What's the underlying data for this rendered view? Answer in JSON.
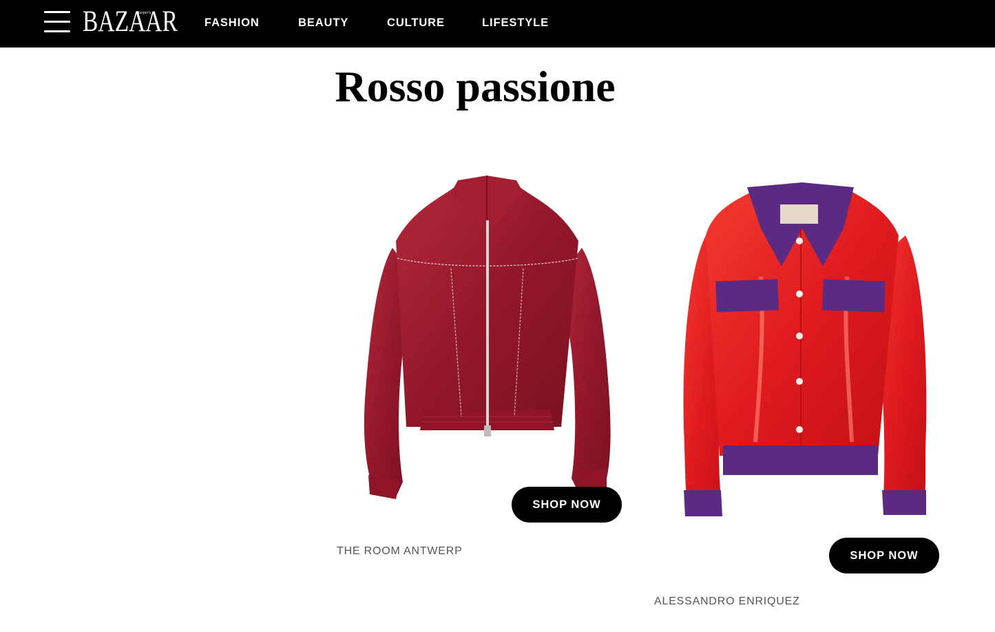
{
  "header": {
    "logo_text": "BAZAAR",
    "logo_sub": "Harper's",
    "nav": [
      "FASHION",
      "BEAUTY",
      "CULTURE",
      "LIFESTYLE"
    ]
  },
  "article": {
    "title": "Rosso passione"
  },
  "products": [
    {
      "brand": "THE ROOM ANTWERP",
      "cta": "SHOP NOW",
      "image": "burgundy-velvet-bomber-jacket"
    },
    {
      "brand": "ALESSANDRO ENRIQUEZ",
      "cta": "SHOP NOW",
      "image": "red-vinyl-jacket-with-purple-trim"
    }
  ],
  "colors": {
    "header_bg": "#000000",
    "accent_burgundy": "#9a1b2e",
    "accent_red": "#e01b1f",
    "accent_purple": "#5b2a82"
  }
}
